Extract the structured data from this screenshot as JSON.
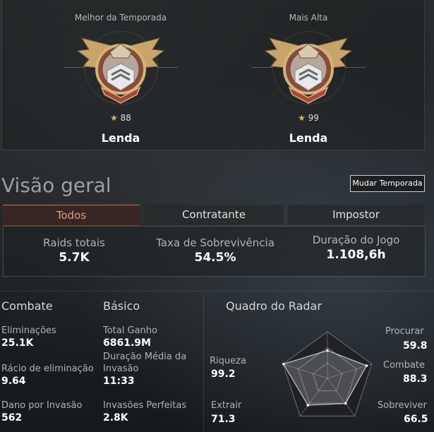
{
  "ranks": [
    {
      "title": "Melhor da Temporada",
      "stars": "88",
      "name": "Lenda"
    },
    {
      "title": "Mais Alta",
      "stars": "99",
      "name": "Lenda"
    }
  ],
  "overview": {
    "title": "Visão geral",
    "change_season_label": "Mudar Temporada"
  },
  "tabs": [
    {
      "label": "Todos",
      "active": true
    },
    {
      "label": "Contratante",
      "active": false
    },
    {
      "label": "Impostor",
      "active": false
    }
  ],
  "summary": [
    {
      "label": "Raids totais",
      "value": "5.7K"
    },
    {
      "label": "Taxa de Sobrevivência",
      "value": "54.5%"
    },
    {
      "label": "Duração do Jogo",
      "value": "1.108,6h"
    }
  ],
  "combat": {
    "title": "Combate",
    "stats": [
      {
        "label": "Eliminações",
        "value": "25.1K"
      },
      {
        "label": "Rácio de eliminação",
        "value": "9.64"
      },
      {
        "label": "Dano por Invasão",
        "value": "562"
      }
    ]
  },
  "basic": {
    "title": "Básico",
    "stats": [
      {
        "label": "Total Ganho",
        "value": "6861.9M"
      },
      {
        "label": "Duração Média da Invasão",
        "value": "11:33"
      },
      {
        "label": "Invasões Perfeitas",
        "value": "2.8K"
      }
    ]
  },
  "radar": {
    "title": "Quadro do Radar",
    "axes": [
      {
        "label": "Procurar",
        "value": "59.8"
      },
      {
        "label": "Combate",
        "value": "88.3"
      },
      {
        "label": "Sobreviver",
        "value": "66.5"
      },
      {
        "label": "Extrair",
        "value": "71.3"
      },
      {
        "label": "Riqueza",
        "value": "99.2"
      }
    ]
  },
  "colors": {
    "accent": "#e49a7e",
    "medal_gold": "#c9a46a"
  }
}
